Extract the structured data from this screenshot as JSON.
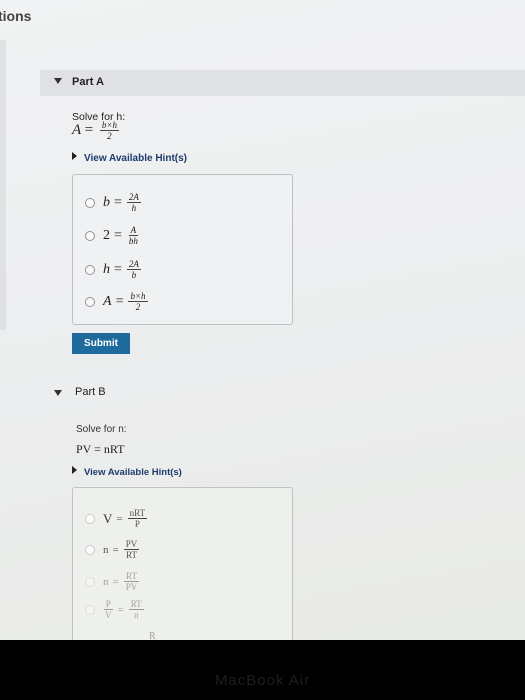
{
  "header": {
    "partial_title": "tions"
  },
  "part_a": {
    "title": "Part A",
    "prompt": "Solve for h:",
    "equation": {
      "lhs": "A",
      "eq": "=",
      "num": "b×h",
      "den": "2"
    },
    "hint_label": "View Available Hint(s)",
    "choices": [
      {
        "lhs": "b",
        "eq": "=",
        "num": "2A",
        "den": "h"
      },
      {
        "lhs": "2",
        "eq": "=",
        "num": "A",
        "den": "bh"
      },
      {
        "lhs": "h",
        "eq": "=",
        "num": "2A",
        "den": "b"
      },
      {
        "lhs": "A",
        "eq": "=",
        "num": "b×h",
        "den": "2"
      }
    ],
    "submit_label": "Submit"
  },
  "part_b": {
    "title": "Part B",
    "prompt": "Solve for n:",
    "equation": "PV = nRT",
    "hint_label": "View Available Hint(s)",
    "choices": [
      {
        "lhs": "V",
        "eq": "=",
        "num": "nRT",
        "den": "P"
      },
      {
        "lhs": "n",
        "eq": "=",
        "num": "PV",
        "den": "RT"
      },
      {
        "lhs": "n",
        "eq": "=",
        "num": "RT",
        "den": "PV"
      },
      {
        "lhs_num": "P",
        "lhs_den": "V",
        "eq": "=",
        "num": "RT",
        "den": "n"
      }
    ],
    "cut_off_text": "R"
  },
  "device": {
    "brand": "MacBook Air"
  }
}
